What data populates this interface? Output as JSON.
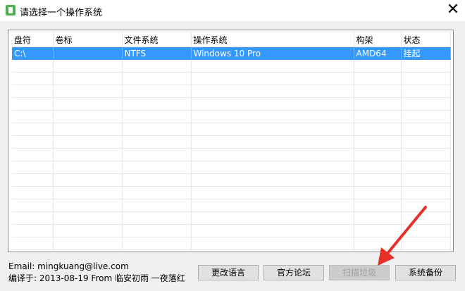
{
  "window": {
    "title": "请选择一个操作系统",
    "close_glyph": "✕"
  },
  "table": {
    "columns": [
      "盘符",
      "卷标",
      "文件系统",
      "操作系统",
      "构架",
      "状态"
    ],
    "rows": [
      [
        "C:\\",
        "",
        "NTFS",
        "Windows 10 Pro",
        "AMD64",
        "挂起"
      ]
    ],
    "empty_rows": 15,
    "selection_color": "#3399ff"
  },
  "footer": {
    "email_line": "Email:  mingkuang@live.com",
    "compile_line": "编译于: 2013-08-19 From 临安初雨 一夜落红"
  },
  "buttons": {
    "change_language": "更改语言",
    "official_forum": "官方论坛",
    "scan_junk": "扫描垃圾",
    "system_backup": "系统备份"
  },
  "annotation": {
    "arrow_color": "#e8302a"
  }
}
